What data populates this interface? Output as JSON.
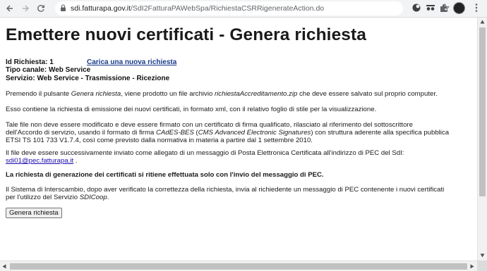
{
  "browser": {
    "url_host": "sdi.fatturapa.gov.it",
    "url_path": "/SdI2FatturaPAWebSpa/RichiestaCSRRigenerateAction.do"
  },
  "page": {
    "title": "Emettere nuovi certificati - Genera richiesta",
    "id_label": "Id Richiesta: 1",
    "new_request_link": "Carica una nuova richiesta",
    "channel_type": "Tipo canale: Web Service",
    "service": "Servizio: Web Service - Trasmissione - Ricezione",
    "p1_a": "Premendo il pulsante ",
    "p1_b": "Genera richiesta",
    "p1_c": ", viene prodotto un file archivio ",
    "p1_d": "richiestaAccreditamento.zip",
    "p1_e": " che deve essere salvato sul proprio computer.",
    "p2": "Esso contiene la richiesta di emissione dei nuovi certificati, in formato xml, con il relativo foglio di stile per la visualizzazione.",
    "p3_line1": "Tale file non deve essere modificato e deve essere firmato con un certificato di firma qualificato, rilasciato al riferimento del sottoscrittore",
    "p3_line2_a": "dell'Accordo di servizio, usando il formato di firma ",
    "p3_line2_b": "CAdES-BES",
    "p3_line2_c": " (",
    "p3_line2_d": "CMS Advanced Electronic Signatures",
    "p3_line2_e": ") con struttura aderente alla specifica pubblica",
    "p3_line3": "ETSI TS 101 733 V1.7.4, così come previsto dalla normativa in materia a partire dal 1 settembre 2010.",
    "p4_line1": "Il file deve essere successivamente inviato come allegato di un messaggio di Posta Elettronica Certificata all'indirizzo di PEC del SdI:",
    "p4_email": "sdi01@pec.fatturapa.it",
    "p4_tail": " .",
    "p5": "La richiesta di generazione dei certificati si ritiene effettuata solo con l'invio del messaggio di PEC.",
    "p6_line1": "Il Sistema di Interscambio, dopo aver verificato la correttezza della richiesta, invia al richiedente un messaggio di PEC contenente i nuovi certificati",
    "p6_line2_a": "per l'utilizzo del Servizio ",
    "p6_line2_b": "SDICoop",
    "p6_line2_c": ".",
    "button_label": "Genera richiesta"
  }
}
